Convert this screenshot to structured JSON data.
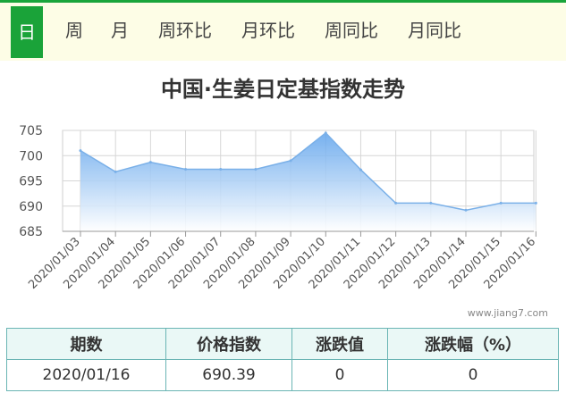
{
  "tabs": [
    "日",
    "周",
    "月",
    "周环比",
    "月环比",
    "周同比",
    "月同比"
  ],
  "active_tab": 0,
  "watermark": "www.jiang7.com",
  "chart_data": {
    "type": "area",
    "title": "中国·生姜日定基指数走势",
    "x": [
      "2020/01/03",
      "2020/01/04",
      "2020/01/05",
      "2020/01/06",
      "2020/01/07",
      "2020/01/08",
      "2020/01/09",
      "2020/01/10",
      "2020/01/11",
      "2020/01/12",
      "2020/01/13",
      "2020/01/14",
      "2020/01/15",
      "2020/01/16"
    ],
    "y": [
      701.0,
      696.8,
      698.7,
      697.3,
      697.3,
      697.3,
      699.0,
      704.5,
      697.2,
      690.6,
      690.6,
      689.2,
      690.6,
      690.6
    ],
    "ylim": [
      685,
      705
    ],
    "yticks": [
      705,
      700,
      695,
      690,
      685
    ],
    "grid": true,
    "colors": {
      "line": "#7ab0e8",
      "fill_top": "#6aa9ee",
      "fill_bottom": "#ffffff"
    }
  },
  "table": {
    "headers": [
      "期数",
      "价格指数",
      "涨跌值",
      "涨跌幅（%）"
    ],
    "row": [
      "2020/01/16",
      "690.39",
      "0",
      "0"
    ]
  }
}
